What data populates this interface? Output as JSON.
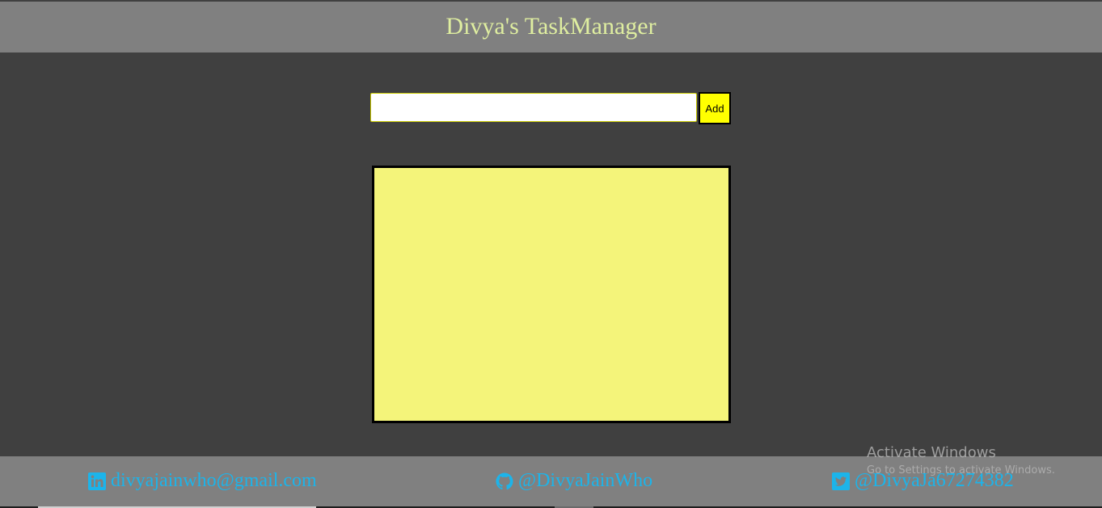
{
  "header": {
    "title": "Divya's TaskManager"
  },
  "add_form": {
    "input_value": "",
    "input_placeholder": "",
    "add_label": "Add"
  },
  "task_list": {
    "items": []
  },
  "footer": {
    "email": {
      "icon": "linkedin-icon",
      "text": "divyajainwho@gmail.com"
    },
    "github": {
      "icon": "github-icon",
      "text": "@DivyaJainWho"
    },
    "twitter": {
      "icon": "twitter-icon",
      "text": "@DivyaJa67274382"
    }
  },
  "watermark": {
    "title": "Activate Windows",
    "subtitle": "Go to Settings to activate Windows."
  },
  "colors": {
    "background": "#404040",
    "bar": "#808080",
    "title_text": "#dfeea0",
    "accent_yellow": "#ffff00",
    "task_list_bg": "#f4f47a",
    "link_blue": "#1cb4ea"
  }
}
